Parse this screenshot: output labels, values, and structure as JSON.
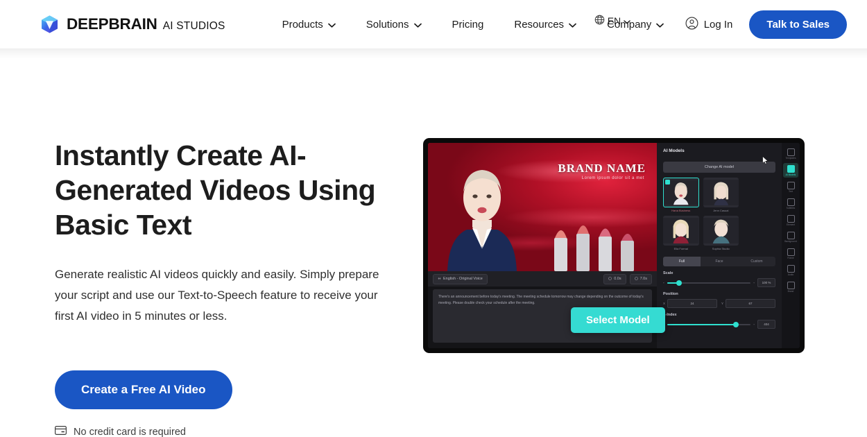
{
  "brand": {
    "name": "DEEPBRAIN",
    "sub": "AI STUDIOS",
    "logo_icon": "cube-logo-icon"
  },
  "header": {
    "nav": [
      {
        "label": "Products",
        "has_chevron": true
      },
      {
        "label": "Solutions",
        "has_chevron": true
      },
      {
        "label": "Pricing",
        "has_chevron": false
      },
      {
        "label": "Resources",
        "has_chevron": true
      },
      {
        "label": "Company",
        "has_chevron": true
      }
    ],
    "language": {
      "label": "EN",
      "icon": "globe-icon"
    },
    "login": {
      "label": "Log In",
      "icon": "user-circle-icon"
    },
    "cta": {
      "label": "Talk to Sales"
    },
    "accent_color": "#1a56c4"
  },
  "hero": {
    "heading": "Instantly Create AI-Generated Videos Using Basic Text",
    "paragraph": "Generate realistic AI videos quickly and easily. Simply prepare your script and use our Text-to-Speech feature to receive your first AI video in 5 minutes or less.",
    "cta_label": "Create a Free AI Video",
    "note": {
      "label": "No credit card is required",
      "icon": "credit-card-icon"
    }
  },
  "preview": {
    "video": {
      "brand_title": "BRAND NAME",
      "brand_sub": "Lorem ipsum dolor sit a met"
    },
    "toolbar": {
      "voice_chip": "English - Original Voice",
      "time_chip_1": "0.0s",
      "time_chip_2": "7.0s"
    },
    "script_text": "There's an announcement before today's meeting. The meeting schedule tomorrow may change depending on the outcome of today's meeting. Please double check your schedule after the meeting.",
    "overlay_button": "Select Model",
    "panel": {
      "title": "AI Models",
      "change_button": "Change AI model",
      "models": [
        {
          "label": "Hana Business",
          "selected": true
        },
        {
          "label": "Jenn Casual",
          "selected": false
        },
        {
          "label": "Ella Formal",
          "selected": false
        },
        {
          "label": "Sophia Studio",
          "selected": false
        }
      ],
      "segments": [
        {
          "label": "Full",
          "active": true
        },
        {
          "label": "Face",
          "active": false
        },
        {
          "label": "Custom",
          "active": false
        }
      ],
      "scale": {
        "label": "Scale",
        "value": "100 %",
        "percent": 14
      },
      "position": {
        "label": "Position",
        "x_key": "X",
        "x_value": "24",
        "y_key": "Y",
        "y_value": "67"
      },
      "zindex": {
        "label": "Z-Index",
        "value": "404",
        "percent": 82
      }
    },
    "rail": [
      {
        "label": "Templates",
        "active": false,
        "icon": "templates-icon"
      },
      {
        "label": "AI Models",
        "active": true,
        "icon": "ai-model-icon"
      },
      {
        "label": "Text",
        "active": false,
        "icon": "text-icon"
      },
      {
        "label": "Subtitles",
        "active": false,
        "icon": "subtitles-icon"
      },
      {
        "label": "Element",
        "active": false,
        "icon": "element-icon"
      },
      {
        "label": "Background",
        "active": false,
        "icon": "background-icon"
      },
      {
        "label": "Frame",
        "active": false,
        "icon": "frame-icon"
      },
      {
        "label": "Audio",
        "active": false,
        "icon": "audio-icon"
      },
      {
        "label": "Brand",
        "active": false,
        "icon": "brand-icon"
      }
    ]
  }
}
